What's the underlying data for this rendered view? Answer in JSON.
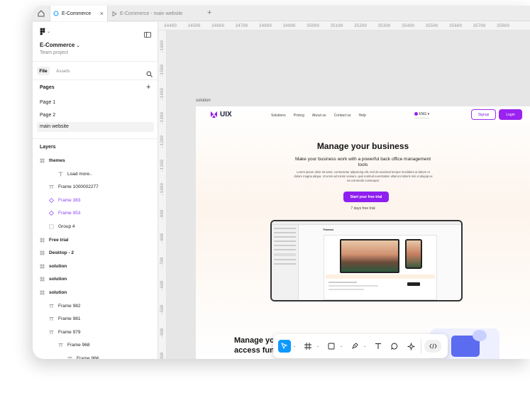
{
  "tabs": [
    {
      "label": "E-Commerce"
    },
    {
      "label": "E-Commerce - main website"
    }
  ],
  "sidebar": {
    "project_name": "E-Commerce",
    "project_sub": "Team project",
    "file_tab": "File",
    "assets_tab": "Assets",
    "pages_heading": "Pages",
    "pages": [
      "Page 1",
      "Page 2",
      "main website"
    ],
    "layers_heading": "Layers",
    "layers": [
      {
        "label": "themes",
        "bold": true,
        "indent": 0,
        "icon": "grid"
      },
      {
        "label": "Load more..",
        "bold": false,
        "indent": 2,
        "icon": "text"
      },
      {
        "label": "Frame 1000002277",
        "bold": false,
        "indent": 1,
        "icon": "frame"
      },
      {
        "label": "Frame 383",
        "bold": false,
        "indent": 1,
        "icon": "component",
        "color": "#8a3ff2"
      },
      {
        "label": "Frame 953",
        "bold": false,
        "indent": 1,
        "icon": "component",
        "color": "#8a3ff2"
      },
      {
        "label": "Group 4",
        "bold": false,
        "indent": 1,
        "icon": "group"
      },
      {
        "label": "Free trial",
        "bold": true,
        "indent": 0,
        "icon": "grid"
      },
      {
        "label": "Desktop - 2",
        "bold": true,
        "indent": 0,
        "icon": "grid"
      },
      {
        "label": "solution",
        "bold": true,
        "indent": 0,
        "icon": "grid"
      },
      {
        "label": "solution",
        "bold": true,
        "indent": 0,
        "icon": "grid"
      },
      {
        "label": "solution",
        "bold": true,
        "indent": 0,
        "icon": "grid"
      },
      {
        "label": "Frame 982",
        "bold": false,
        "indent": 1,
        "icon": "frame"
      },
      {
        "label": "Frame 981",
        "bold": false,
        "indent": 1,
        "icon": "frame"
      },
      {
        "label": "Frame 979",
        "bold": false,
        "indent": 1,
        "icon": "frame"
      },
      {
        "label": "Frame 968",
        "bold": false,
        "indent": 2,
        "icon": "frame"
      },
      {
        "label": "Frame 966",
        "bold": false,
        "indent": 3,
        "icon": "frame"
      }
    ]
  },
  "ruler": {
    "top": [
      "34400",
      "34500",
      "34600",
      "34700",
      "34800",
      "34900",
      "35000",
      "35100",
      "35200",
      "35300",
      "35400",
      "35500",
      "35600",
      "35700",
      "35800"
    ],
    "left": [
      "-1600",
      "-1500",
      "-1400",
      "-1300",
      "-1200",
      "-1100",
      "-1000",
      "-900",
      "-800",
      "-700",
      "-600",
      "-500",
      "-400",
      "-300"
    ]
  },
  "canvas": {
    "frame_label": "solution",
    "logo_text": "UIX",
    "nav_links": [
      "Solutions",
      "Pricing",
      "About us",
      "Contact us",
      "Help"
    ],
    "lang": "ENG",
    "signup": "Signup",
    "login": "Login",
    "hero_title": "Manage your business",
    "hero_subtitle": "Make your business work with a powerful back office management tools",
    "hero_body": "Lorem ipsum dolor sit amet, consectetur adipiscing elit, sed do eiusmod tempor incididunt ut labore et dolore magna aliqua. Ut enim ad minim veniam, quis nostrud exercitation ullamco laboris nisi ut aliquip ex ea commodo consequat.",
    "cta": "Start your free trial",
    "trial_note": "7 days free trial",
    "mock_heading": "Themes",
    "bottom_title_1": "Manage yo",
    "bottom_title_2": "access fundi"
  },
  "toolbar": {
    "tools": [
      "move-tool",
      "frame-tool",
      "shape-tool",
      "pen-tool",
      "text-tool",
      "comment-tool",
      "actions-tool",
      "dev-mode-toggle"
    ]
  },
  "colors": {
    "accent": "#9b22f0",
    "selection": "#0d99ff",
    "component": "#8a3ff2"
  }
}
